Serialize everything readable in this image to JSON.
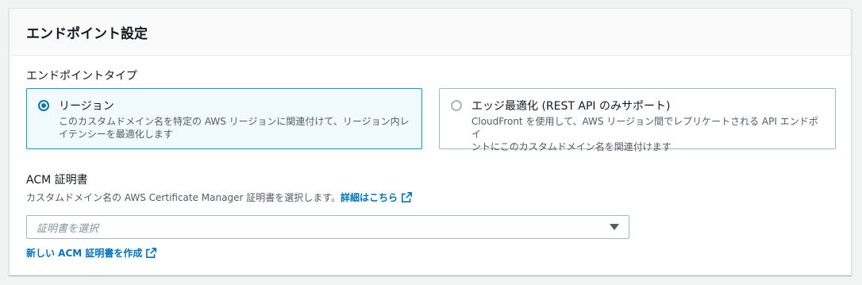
{
  "panel": {
    "title": "エンドポイント設定"
  },
  "endpoint_type": {
    "label": "エンドポイントタイプ",
    "options": [
      {
        "label": "リージョン",
        "description_line1": "このカスタムドメイン名を特定の AWS リージョンに関連付けて、リージョン内レ",
        "description_line2": "イテンシーを最適化します",
        "selected": true
      },
      {
        "label": "エッジ最適化 (REST API のみサポート)",
        "description_line1": "CloudFront を使用して、AWS リージョン間でレプリケートされる API エンドポイ",
        "description_line2": "ントにこのカスタムドメイン名を関連付けます",
        "selected": false
      }
    ]
  },
  "acm": {
    "label": "ACM 証明書",
    "description": "カスタムドメイン名の AWS Certificate Manager 証明書を選択します。",
    "learn_more": "詳細はこちら",
    "select_placeholder": "証明書を選択",
    "create_link": "新しい ACM 証明書を作成"
  },
  "icons": {
    "external": "external-link-icon",
    "caret": "caret-down-icon"
  },
  "colors": {
    "accent": "#0073bb",
    "selected_border": "#00a1c9",
    "selected_bg": "#f1faff"
  }
}
